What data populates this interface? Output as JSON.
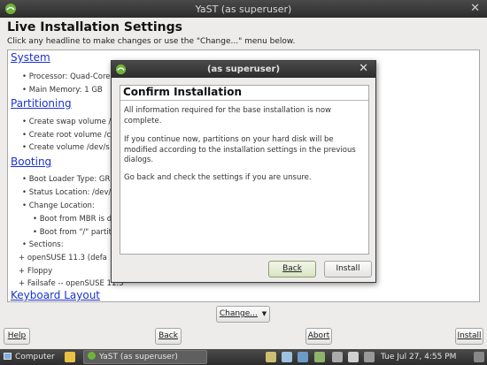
{
  "window": {
    "title": "YaST (as superuser)"
  },
  "header": {
    "title": "Live Installation Settings",
    "subtitle": "Click any headline to make changes or use the \"Change...\" menu below."
  },
  "overview": {
    "system": {
      "title": "System",
      "items": [
        "• Processor: Quad-Core",
        "• Main Memory: 1 GB"
      ]
    },
    "partitioning": {
      "title": "Partitioning",
      "items": [
        "• Create swap volume /",
        "• Create root volume /c",
        "• Create volume /dev/s"
      ]
    },
    "booting": {
      "title": "Booting",
      "items": [
        "• Boot Loader Type: GR",
        "• Status Location: /dev/",
        "• Change Location:",
        "• Boot from MBR is d",
        "• Boot from \"/\" partit",
        "• Sections:",
        "+ openSUSE 11.3 (defa",
        "+ Floppy",
        "+ Failsafe -- openSUSE 11.3"
      ]
    },
    "keyboard": {
      "title": "Keyboard Layout"
    }
  },
  "dialog": {
    "title": "(as superuser)",
    "heading": "Confirm Installation",
    "paragraphs": [
      "All information required for the base installation is now complete.",
      "If you continue now, partitions on your hard disk will be modified according to the installation settings in the previous dialogs.",
      "Go back and check the settings if you are unsure."
    ],
    "back_label": "Back",
    "install_label": "Install"
  },
  "change_menu": {
    "label": "Change...",
    "arrow": "chevron-down-icon"
  },
  "footer": {
    "help": "Help",
    "back": "Back",
    "abort": "Abort",
    "install": "Install"
  },
  "taskbar": {
    "computer": "Computer",
    "task": "YaST (as superuser)",
    "clock": "Tue Jul 27,  4:55 PM"
  },
  "colors": {
    "link": "#1a33cc",
    "titlebar": "#2c2c2c",
    "focus_button": "#d9e3c3"
  }
}
